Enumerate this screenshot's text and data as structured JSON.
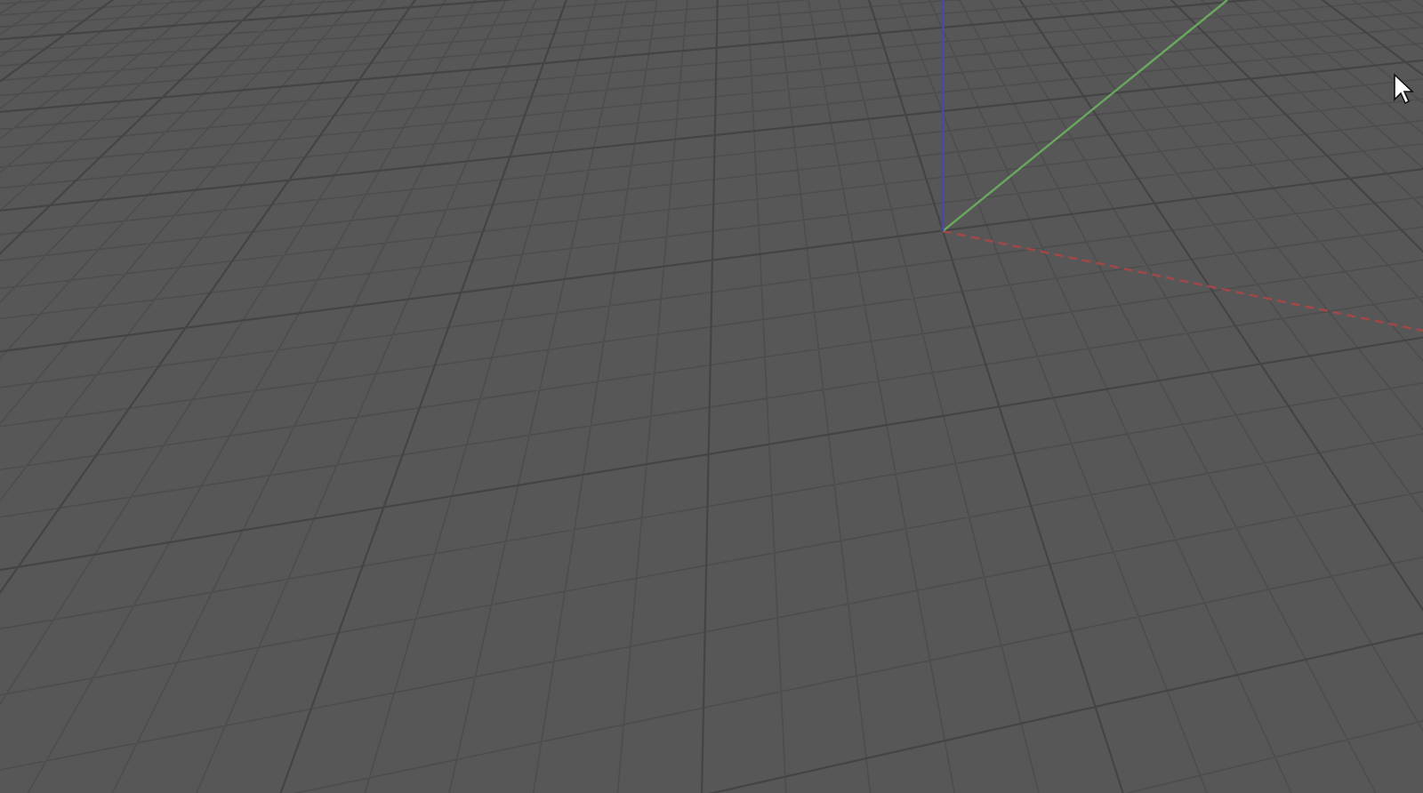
{
  "viewport": {
    "axes": [
      {
        "kind": "x",
        "color": "#a04848"
      },
      {
        "kind": "y",
        "color": "#6aa860"
      },
      {
        "kind": "z",
        "color": "#4a4a9a"
      }
    ]
  }
}
